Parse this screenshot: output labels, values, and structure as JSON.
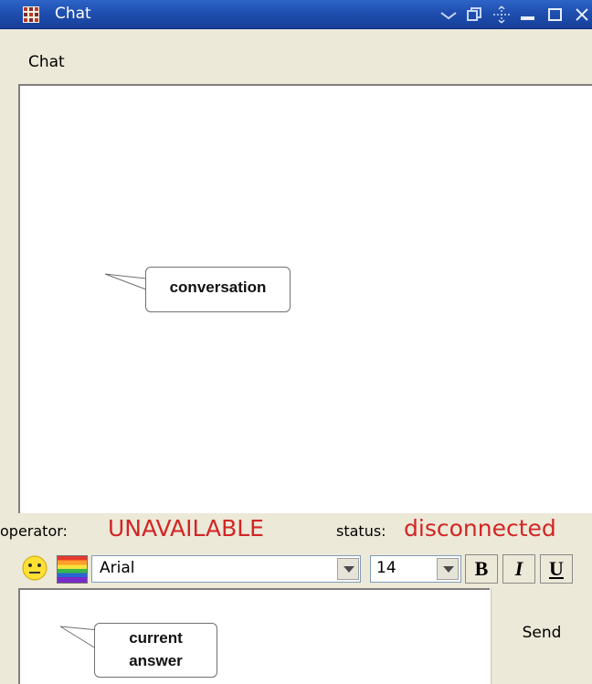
{
  "window": {
    "title": "Chat",
    "title_icon": "grid-app-icon",
    "controls": [
      "chevron-down-icon",
      "restore-icon",
      "move-icon",
      "minimize-icon",
      "maximize-icon",
      "close-icon"
    ]
  },
  "menu": {
    "items": [
      {
        "label": "Chat"
      }
    ]
  },
  "conversation": {
    "callout": "conversation"
  },
  "status": {
    "operator_label": "operator:",
    "operator_value": "UNAVAILABLE",
    "status_label": "status:",
    "status_value": "disconnected",
    "value_color": "#d22626"
  },
  "toolbar": {
    "emoji_icon": "smiley-icon",
    "color_icon": "color-palette-icon",
    "font": "Arial",
    "size": "14",
    "bold_label": "B",
    "italic_label": "I",
    "underline_label": "U"
  },
  "answer": {
    "callout_line1": "current",
    "callout_line2": "answer",
    "send_label": "Send"
  },
  "colors": {
    "titlebar": "#1f4fb0",
    "chrome": "#ece9d8",
    "accent_red": "#d22626"
  }
}
